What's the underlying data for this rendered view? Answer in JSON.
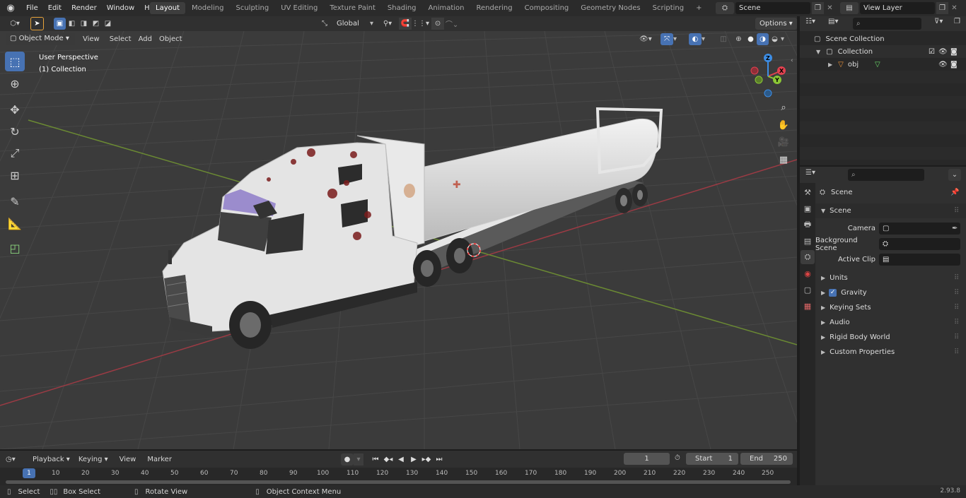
{
  "menubar": {
    "items": [
      "File",
      "Edit",
      "Render",
      "Window",
      "Help"
    ],
    "workspaces": [
      "Layout",
      "Modeling",
      "Sculpting",
      "UV Editing",
      "Texture Paint",
      "Shading",
      "Animation",
      "Rendering",
      "Compositing",
      "Geometry Nodes",
      "Scripting"
    ],
    "active_workspace": "Layout",
    "add_tab": "+",
    "scene_name": "Scene",
    "view_layer": "View Layer"
  },
  "viewport_header": {
    "mode": "Object Mode",
    "menus": [
      "View",
      "Select",
      "Add",
      "Object"
    ],
    "transform_orientation": "Global",
    "options_label": "Options"
  },
  "viewport": {
    "perspective_label": "User Perspective",
    "collection_label": "(1) Collection",
    "gizmo_axes": {
      "x": "X",
      "y": "Y",
      "z": "Z"
    }
  },
  "outliner": {
    "scene_collection": "Scene Collection",
    "collection": "Collection",
    "object": "obj"
  },
  "properties": {
    "context": "Scene",
    "panel_scene": "Scene",
    "camera_label": "Camera",
    "background_scene_label": "Background Scene",
    "active_clip_label": "Active Clip",
    "subpanels": [
      "Units",
      "Gravity",
      "Keying Sets",
      "Audio",
      "Rigid Body World",
      "Custom Properties"
    ]
  },
  "timeline": {
    "menus": [
      "Playback",
      "Keying",
      "View",
      "Marker"
    ],
    "current_frame": "1",
    "start_label": "Start",
    "start_value": "1",
    "end_label": "End",
    "end_value": "250",
    "ruler": [
      "1",
      "10",
      "20",
      "30",
      "40",
      "50",
      "60",
      "70",
      "80",
      "90",
      "100",
      "110",
      "120",
      "130",
      "140",
      "150",
      "160",
      "170",
      "180",
      "190",
      "200",
      "210",
      "220",
      "230",
      "240",
      "250"
    ]
  },
  "statusbar": {
    "select": "Select",
    "box_select": "Box Select",
    "rotate_view": "Rotate View",
    "context_menu": "Object Context Menu",
    "version": "2.93.8"
  },
  "colors": {
    "accent": "#4772b3",
    "x_axis": "#e0414f",
    "y_axis": "#8bc735",
    "z_axis": "#3d8ee6"
  }
}
